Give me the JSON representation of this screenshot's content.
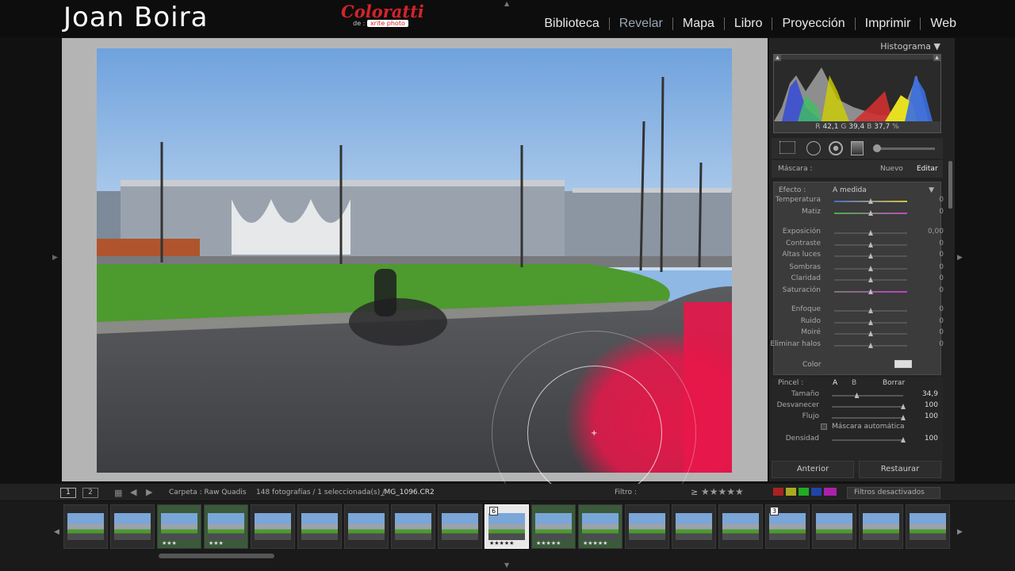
{
  "header": {
    "brand": "Joan Boira",
    "sponsor": {
      "title": "Coloratti",
      "prefix": "de :",
      "logo": "xrite photo"
    },
    "modules": [
      "Biblioteca",
      "Revelar",
      "Mapa",
      "Libro",
      "Proyección",
      "Imprimir",
      "Web"
    ],
    "active_module": "Revelar"
  },
  "histogram": {
    "title": "Histograma ▼",
    "readout": {
      "r_label": "R",
      "r": "42,1",
      "g_label": "G",
      "g": "39,4",
      "b_label": "B",
      "b": "37,7",
      "unit": "%"
    }
  },
  "mask": {
    "label": "Máscara :",
    "new": "Nuevo",
    "edit": "Editar"
  },
  "effect": {
    "label": "Efecto :",
    "value": "A medida",
    "arrow": "▼"
  },
  "sliders": [
    {
      "name": "Temperatura",
      "value": "0",
      "pos": 0.5,
      "grad": "linear-gradient(90deg,#4a6ec4,#d8c040)"
    },
    {
      "name": "Matiz",
      "value": "0",
      "pos": 0.5,
      "grad": "linear-gradient(90deg,#4ab04a,#c04ac0)"
    },
    {
      "name": "Exposición",
      "value": "0,00",
      "pos": 0.5
    },
    {
      "name": "Contraste",
      "value": "0",
      "pos": 0.5
    },
    {
      "name": "Altas luces",
      "value": "0",
      "pos": 0.5
    },
    {
      "name": "Sombras",
      "value": "0",
      "pos": 0.5
    },
    {
      "name": "Claridad",
      "value": "0",
      "pos": 0.5
    },
    {
      "name": "Saturación",
      "value": "0",
      "pos": 0.5,
      "grad": "linear-gradient(90deg,#777,#c040c0)"
    },
    {
      "name": "Enfoque",
      "value": "0",
      "pos": 0.5
    },
    {
      "name": "Ruido",
      "value": "0",
      "pos": 0.5
    },
    {
      "name": "Moiré",
      "value": "0",
      "pos": 0.5
    },
    {
      "name": "Eliminar halos",
      "value": "0",
      "pos": 0.5
    }
  ],
  "color_label": "Color",
  "brush": {
    "label": "Pincel :",
    "a": "A",
    "b": "B",
    "erase": "Borrar",
    "size": {
      "name": "Tamaño",
      "value": "34,9",
      "pos": 0.35
    },
    "feather": {
      "name": "Desvanecer",
      "value": "100",
      "pos": 1.0
    },
    "flow": {
      "name": "Flujo",
      "value": "100",
      "pos": 1.0
    },
    "automask": "Máscara automática",
    "density": {
      "name": "Densidad",
      "value": "100",
      "pos": 1.0
    }
  },
  "buttons": {
    "previous": "Anterior",
    "reset": "Restaurar"
  },
  "filmbar": {
    "screen1": "1",
    "screen2": "2",
    "folder": "Carpeta : Raw Quadis",
    "count": "148 fotografías / 1 seleccionada(s) /",
    "filename": "_MG_1096.CR2",
    "filter_label": "Filtro :",
    "rating_op": "≥",
    "filter_value": "Filtros desactivados"
  },
  "thumbnails": [
    {
      "stars": "",
      "flag": "",
      "tint": "none"
    },
    {
      "stars": "",
      "flag": "",
      "tint": "none"
    },
    {
      "stars": "★★★",
      "flag": "",
      "tint": "green"
    },
    {
      "stars": "★★★",
      "flag": "",
      "tint": "green"
    },
    {
      "stars": "",
      "flag": "",
      "tint": "none"
    },
    {
      "stars": "",
      "flag": "",
      "tint": "none"
    },
    {
      "stars": "",
      "flag": "",
      "tint": "none"
    },
    {
      "stars": "",
      "flag": "",
      "tint": "none"
    },
    {
      "stars": "",
      "flag": "",
      "tint": "none"
    },
    {
      "stars": "★★★★★",
      "flag": "6",
      "tint": "selected"
    },
    {
      "stars": "★★★★★",
      "flag": "",
      "tint": "green"
    },
    {
      "stars": "★★★★★",
      "flag": "",
      "tint": "green"
    },
    {
      "stars": "",
      "flag": "",
      "tint": "none"
    },
    {
      "stars": "",
      "flag": "",
      "tint": "none"
    },
    {
      "stars": "",
      "flag": "",
      "tint": "none"
    },
    {
      "stars": "",
      "flag": "3",
      "tint": "none"
    },
    {
      "stars": "",
      "flag": "",
      "tint": "none"
    },
    {
      "stars": "",
      "flag": "",
      "tint": "none"
    },
    {
      "stars": "",
      "flag": "",
      "tint": "none"
    }
  ],
  "colors": {
    "accent": "#d2242b",
    "mask_overlay": "#e8174a",
    "panel": "#232323"
  }
}
